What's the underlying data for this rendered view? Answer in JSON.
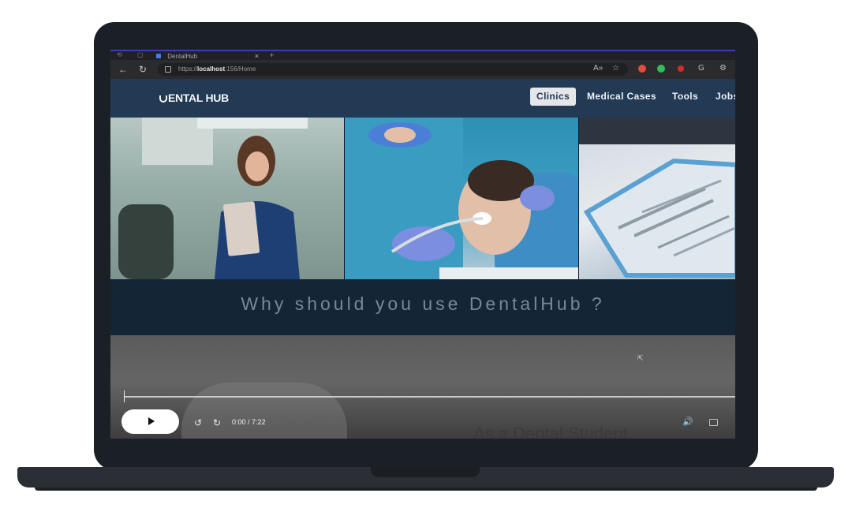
{
  "browser": {
    "tab_title": "DentalHub",
    "tab_close": "×",
    "tab_new": "+",
    "url_prefix": "https://",
    "url_host": "localhost",
    "url_path": ":156/Home",
    "icons": [
      "back-arrow-icon",
      "refresh-icon",
      "lock-icon",
      "read-aloud-icon",
      "favorite-star-icon",
      "extension-icon",
      "copilot-icon",
      "settings-icon"
    ]
  },
  "site": {
    "logo_text": "ENTAL HUB",
    "nav": [
      {
        "label": "Clinics",
        "active": true
      },
      {
        "label": "Medical Cases",
        "active": false
      },
      {
        "label": "Tools",
        "active": false
      },
      {
        "label": "Jobs",
        "active": false
      }
    ],
    "why_heading": "Why should you use DentalHub ?"
  },
  "video": {
    "time": "0:00 / 7:22",
    "caption": "As a Dental Student",
    "progress": 0,
    "icons": [
      "play-icon",
      "rewind-10-icon",
      "forward-10-icon",
      "volume-icon",
      "captions-icon"
    ]
  },
  "colors": {
    "nav_bg": "#233a55",
    "why_bg": "#142536",
    "frame": "#1b2026"
  }
}
